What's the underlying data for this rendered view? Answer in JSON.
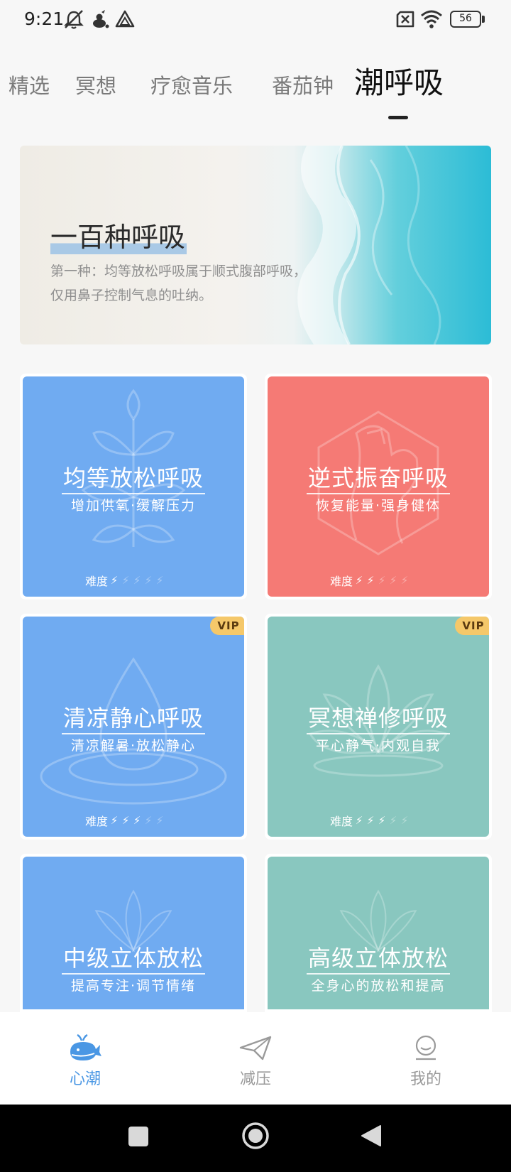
{
  "status_bar": {
    "time": "9:21",
    "battery": "56",
    "icons": [
      "mute-icon",
      "notification-icon",
      "app-icon",
      "sim-off-icon",
      "wifi-icon",
      "battery-icon"
    ]
  },
  "tabs": [
    {
      "label": "精选",
      "active": false
    },
    {
      "label": "冥想",
      "active": false
    },
    {
      "label": "疗愈音乐",
      "active": false
    },
    {
      "label": "番茄钟",
      "active": false
    },
    {
      "label": "潮呼吸",
      "active": true
    }
  ],
  "banner": {
    "title": "一百种呼吸",
    "desc_line1": "第一种：均等放松呼吸属于顺式腹部呼吸，",
    "desc_line2": "仅用鼻子控制气息的吐纳。"
  },
  "cards": [
    {
      "title": "均等放松呼吸",
      "subtitle": "增加供氧·缓解压力",
      "difficulty_label": "难度",
      "difficulty": 1,
      "difficulty_max": 5,
      "vip": false,
      "color": "#70abf1"
    },
    {
      "title": "逆式振奋呼吸",
      "subtitle": "恢复能量·强身健体",
      "difficulty_label": "难度",
      "difficulty": 2,
      "difficulty_max": 5,
      "vip": false,
      "color": "#f57a75"
    },
    {
      "title": "清凉静心呼吸",
      "subtitle": "清凉解暑·放松静心",
      "difficulty_label": "难度",
      "difficulty": 3,
      "difficulty_max": 5,
      "vip": true,
      "vip_label": "VIP",
      "color": "#70abf1"
    },
    {
      "title": "冥想禅修呼吸",
      "subtitle": "平心静气·内观自我",
      "difficulty_label": "难度",
      "difficulty": 3,
      "difficulty_max": 5,
      "vip": true,
      "vip_label": "VIP",
      "color": "#89c7bf"
    },
    {
      "title": "中级立体放松",
      "subtitle": "提高专注·调节情绪",
      "color": "#70abf1"
    },
    {
      "title": "高级立体放松",
      "subtitle": "全身心的放松和提高",
      "color": "#89c7bf"
    }
  ],
  "bottom_nav": [
    {
      "label": "心潮",
      "icon": "whale-icon",
      "active": true
    },
    {
      "label": "减压",
      "icon": "paper-plane-icon",
      "active": false
    },
    {
      "label": "我的",
      "icon": "profile-icon",
      "active": false
    }
  ],
  "system_nav": {
    "icons": [
      "recents-square-icon",
      "home-circle-icon",
      "back-triangle-icon"
    ]
  },
  "colors": {
    "accent": "#4a97e4",
    "card_blue": "#70abf1",
    "card_red": "#f57a75",
    "card_green": "#89c7bf",
    "vip": "#f5c86a"
  }
}
